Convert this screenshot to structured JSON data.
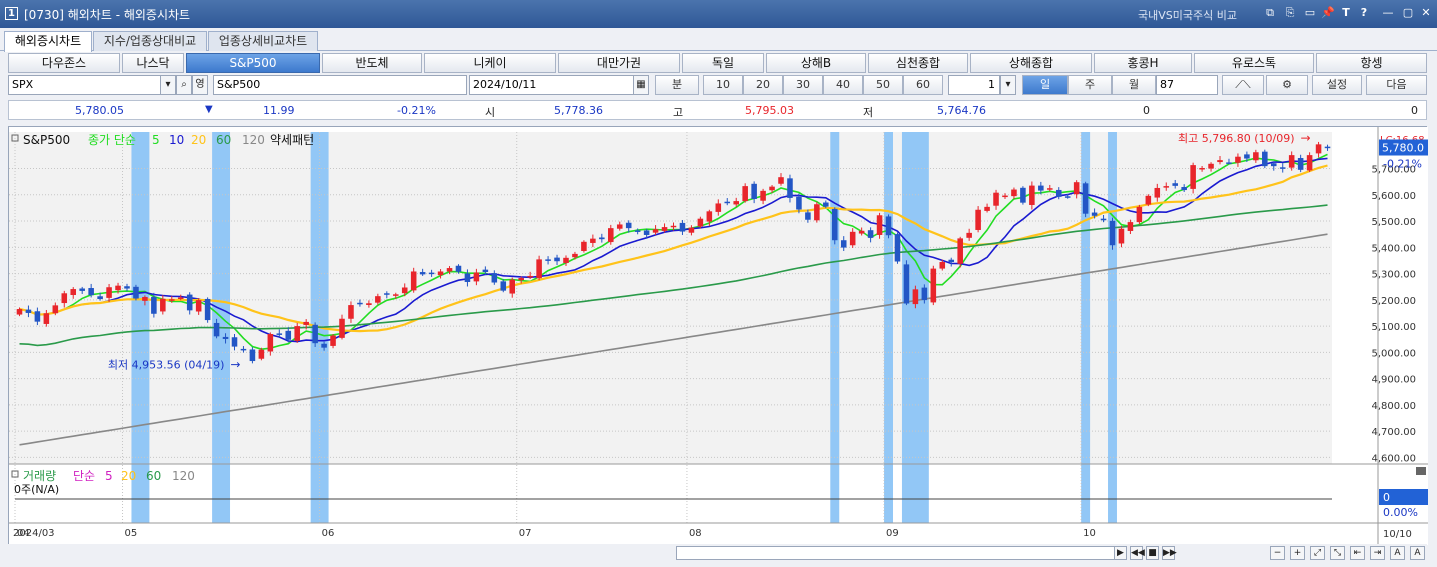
{
  "window": {
    "title": "[0730] 해외차트 - 해외증시차트",
    "compare_label": "국내VS미국주식 비교",
    "buttons": [
      "⧉",
      "⎘",
      "▭",
      "📌",
      "T",
      "?",
      "—",
      "▢",
      "✕"
    ]
  },
  "tabs": [
    "해외증시차트",
    "지수/업종상대비교",
    "업종상세비교차트"
  ],
  "index_buttons": [
    "다우존스",
    "나스닥",
    "S&P500",
    "반도체",
    "니케이",
    "대만가권",
    "독일",
    "상해B",
    "심천종합",
    "상해종합",
    "홍콩H",
    "유로스톡",
    "항셍"
  ],
  "controls": {
    "symbol": "SPX",
    "name": "S&P500",
    "date": "2024/10/11",
    "interval_label": "분",
    "minutes": [
      "10",
      "20",
      "30",
      "40",
      "50",
      "60"
    ],
    "count": "1",
    "day": "일",
    "week": "주",
    "month": "월",
    "bars": "87",
    "settings": "설정",
    "next": "다음",
    "ying_label": "영"
  },
  "quote": {
    "price": "5,780.05",
    "change": "11.99",
    "change_pct": "-0.21%",
    "open_label": "시",
    "open": "5,778.36",
    "high_label": "고",
    "high": "5,795.03",
    "low_label": "저",
    "low": "5,764.76",
    "volume": "0",
    "amount": "0"
  },
  "legend": {
    "name": "S&P500",
    "ma_label": "종가 단순",
    "periods": [
      "5",
      "10",
      "20",
      "60",
      "120"
    ],
    "pattern": "약세패턴",
    "vol_label": "거래량",
    "vol_ma": "단순",
    "vol_periods": [
      "5",
      "20",
      "60",
      "120"
    ],
    "vol_value": "0주(N/A)"
  },
  "colors": {
    "up": "#e8252b",
    "down": "#2356c5",
    "ma5": "#22dd22",
    "ma10": "#1a1ad0",
    "ma20": "#ffc31a",
    "ma60": "#2a9a4a",
    "ma120": "#888888",
    "band": "#8cc4f5",
    "current": "#2262d6"
  },
  "price_axis": [
    "5,700.00",
    "5,600.00",
    "5,500.00",
    "5,400.00",
    "5,300.00",
    "5,200.00",
    "5,100.00",
    "5,000.00",
    "4,900.00",
    "4,800.00",
    "4,700.00",
    "4,600.00"
  ],
  "axis_extra": {
    "lc": "LC:16.68",
    "current": "5,780.0",
    "pct": "-0.21%",
    "vol_current": "0",
    "vol_pct": "0.00%",
    "date_end": "10/10"
  },
  "annotations": {
    "low": "최저 4,953.56 (04/19)",
    "high": "최고 5,796.80 (10/09)"
  },
  "months": [
    "2024/03",
    "04",
    "05",
    "06",
    "07",
    "08",
    "09",
    "10"
  ],
  "chart_data": {
    "type": "candlestick",
    "dates": [
      "03/13",
      "03/14",
      "03/15",
      "03/18",
      "03/19",
      "03/20",
      "03/21",
      "03/22",
      "03/25",
      "03/26",
      "03/27",
      "03/28",
      "04/01",
      "04/02",
      "04/03",
      "04/04",
      "04/05",
      "04/08",
      "04/09",
      "04/10",
      "04/11",
      "04/12",
      "04/15",
      "04/16",
      "04/17",
      "04/18",
      "04/19",
      "04/22",
      "04/23",
      "04/24",
      "04/25",
      "04/26",
      "04/29",
      "04/30",
      "05/01",
      "05/02",
      "05/03",
      "05/06",
      "05/07",
      "05/08",
      "05/09",
      "05/10",
      "05/13",
      "05/14",
      "05/15",
      "05/16",
      "05/17",
      "05/20",
      "05/21",
      "05/22",
      "05/23",
      "05/24",
      "05/28",
      "05/29",
      "05/30",
      "05/31",
      "06/03",
      "06/04",
      "06/05",
      "06/06",
      "06/07",
      "06/10",
      "06/11",
      "06/12",
      "06/13",
      "06/14",
      "06/17",
      "06/18",
      "06/20",
      "06/21",
      "06/24",
      "06/25",
      "06/26",
      "06/27",
      "06/28",
      "07/01",
      "07/02",
      "07/03",
      "07/05",
      "07/08",
      "07/09",
      "07/10",
      "07/11",
      "07/12",
      "07/15",
      "07/16",
      "07/17",
      "07/18",
      "07/19",
      "07/22",
      "07/23",
      "07/24",
      "07/25",
      "07/26",
      "07/29",
      "07/30",
      "07/31",
      "08/01",
      "08/02",
      "08/05",
      "08/06",
      "08/07",
      "08/08",
      "08/09",
      "08/12",
      "08/13",
      "08/14",
      "08/15",
      "08/16",
      "08/19",
      "08/20",
      "08/21",
      "08/22",
      "08/23",
      "08/26",
      "08/27",
      "08/28",
      "08/29",
      "08/30",
      "09/03",
      "09/04",
      "09/05",
      "09/06",
      "09/09",
      "09/10",
      "09/11",
      "09/12",
      "09/13",
      "09/16",
      "09/17",
      "09/18",
      "09/19",
      "09/20",
      "09/23",
      "09/24",
      "09/25",
      "09/26",
      "09/27",
      "09/30",
      "10/01",
      "10/02",
      "10/03",
      "10/04",
      "10/07",
      "10/08",
      "10/09",
      "10/10"
    ],
    "close": [
      5165,
      5150,
      5117,
      5149,
      5179,
      5225,
      5241,
      5234,
      5218,
      5203,
      5248,
      5254,
      5243,
      5205,
      5211,
      5147,
      5204,
      5202,
      5209,
      5160,
      5199,
      5123,
      5061,
      5051,
      5022,
      5011,
      4967,
      5010,
      5070,
      5071,
      5048,
      5100,
      5116,
      5035,
      5018,
      5064,
      5128,
      5180,
      5187,
      5187,
      5214,
      5223,
      5221,
      5247,
      5308,
      5297,
      5303,
      5308,
      5321,
      5307,
      5268,
      5304,
      5306,
      5266,
      5235,
      5277,
      5283,
      5291,
      5354,
      5352,
      5347,
      5360,
      5375,
      5421,
      5433,
      5431,
      5473,
      5487,
      5473,
      5464,
      5447,
      5469,
      5477,
      5482,
      5460,
      5475,
      5509,
      5537,
      5567,
      5572,
      5576,
      5633,
      5584,
      5615,
      5631,
      5667,
      5588,
      5544,
      5505,
      5564,
      5555,
      5427,
      5399,
      5459,
      5463,
      5436,
      5522,
      5446,
      5346,
      5186,
      5240,
      5199,
      5319,
      5344,
      5344,
      5434,
      5455,
      5543,
      5554,
      5608,
      5597,
      5620,
      5570,
      5635,
      5616,
      5625,
      5592,
      5591,
      5648,
      5528,
      5520,
      5503,
      5408,
      5471,
      5496,
      5554,
      5596,
      5626,
      5633,
      5634,
      5618,
      5713,
      5702,
      5718,
      5732,
      5722,
      5745,
      5738,
      5762,
      5709,
      5709,
      5699,
      5751,
      5695,
      5751,
      5792,
      5780
    ],
    "ma_periods": [
      5,
      10,
      20,
      60,
      120
    ],
    "price_ylim": [
      4575,
      5820
    ],
    "highlight_bands": [
      [
        "04/02",
        "04/03"
      ],
      [
        "04/15",
        "04/16"
      ],
      [
        "04/30",
        "05/01"
      ],
      [
        "07/24",
        "07/24"
      ],
      [
        "08/01",
        "08/01"
      ],
      [
        "08/05",
        "08/07"
      ],
      [
        "09/03",
        "09/03"
      ],
      [
        "09/06",
        "09/06"
      ]
    ],
    "title": "S&P500",
    "high_point": {
      "date": "10/09",
      "value": 5796.8
    },
    "low_point": {
      "date": "04/19",
      "value": 4953.56
    }
  }
}
